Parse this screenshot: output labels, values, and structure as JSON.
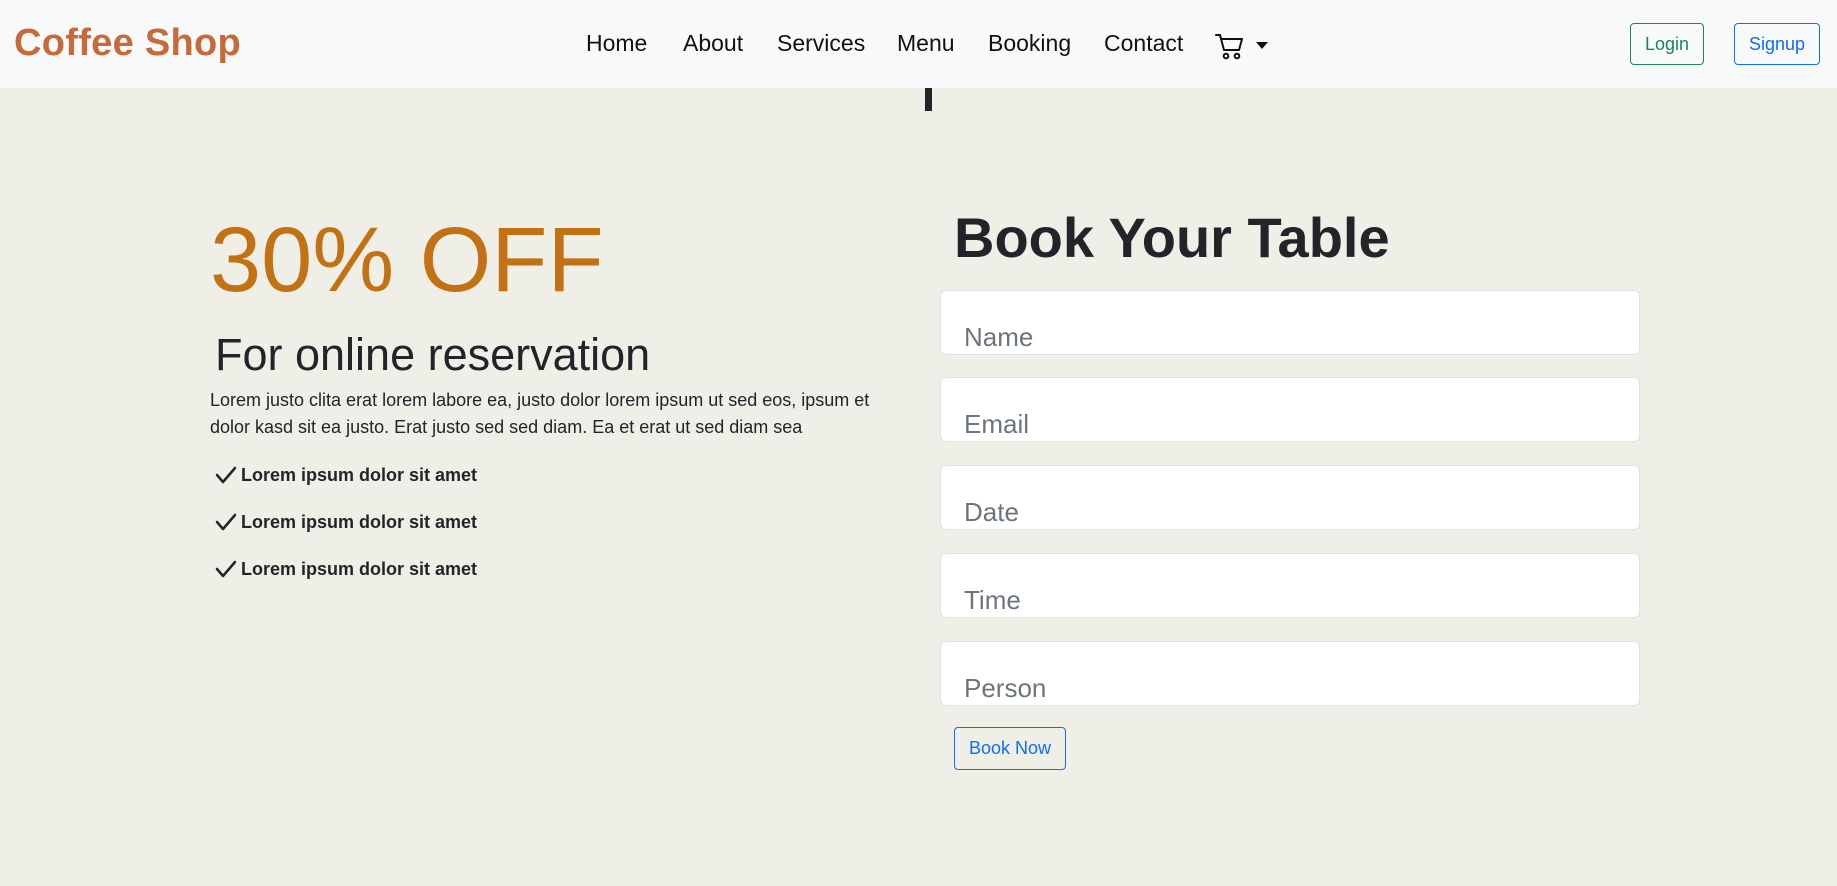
{
  "nav": {
    "brand": "Coffee Shop",
    "links": [
      "Home",
      "About",
      "Services",
      "Menu",
      "Booking",
      "Contact"
    ],
    "cart_icon": "cart-icon",
    "login": "Login",
    "signup": "Signup"
  },
  "promo": {
    "discount": "30% OFF",
    "subtitle": "For online reservation",
    "description": "Lorem justo clita erat lorem labore ea, justo dolor lorem ipsum ut sed eos, ipsum et dolor kasd sit ea justo. Erat justo sed sed diam. Ea et erat ut sed diam sea",
    "features": [
      "Lorem ipsum dolor sit amet",
      "Lorem ipsum dolor sit amet",
      "Lorem ipsum dolor sit amet"
    ]
  },
  "booking": {
    "title": "Book Your Table",
    "fields": {
      "name": "Name",
      "email": "Email",
      "date": "Date",
      "time": "Time",
      "person": "Person"
    },
    "submit": "Book Now"
  },
  "colors": {
    "brand": "#c8693a",
    "discount": "#c27213",
    "background": "#efeee7",
    "navbar": "#f8f9fa",
    "login": "#198754",
    "primary": "#0d6efd"
  }
}
